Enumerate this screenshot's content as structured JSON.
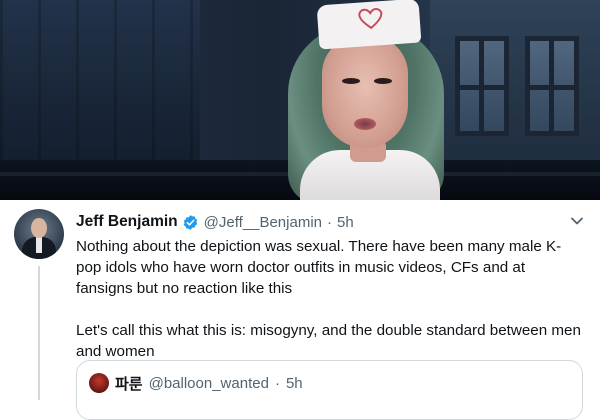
{
  "tweet": {
    "author_name": "Jeff Benjamin",
    "author_handle": "@Jeff__Benjamin",
    "separator": "·",
    "time": "5h",
    "paragraphs": [
      "Nothing about the depiction was sexual. There have been many male K-pop idols who have worn doctor outfits in music videos, CFs and at fansigns but no reaction like this",
      "Let's call this what this is: misogyny, and the double standard between men and women"
    ],
    "icons": {
      "verified": "verified-badge-icon",
      "more": "chevron-down-icon"
    },
    "colors": {
      "verified": "#1d9bf0",
      "secondary_text": "#536471",
      "primary_text": "#0f1419",
      "border": "#cfd9de"
    }
  },
  "quoted_tweet": {
    "author_name": "파룬",
    "author_handle": "@balloon_wanted",
    "separator": "·",
    "time": "5h"
  }
}
